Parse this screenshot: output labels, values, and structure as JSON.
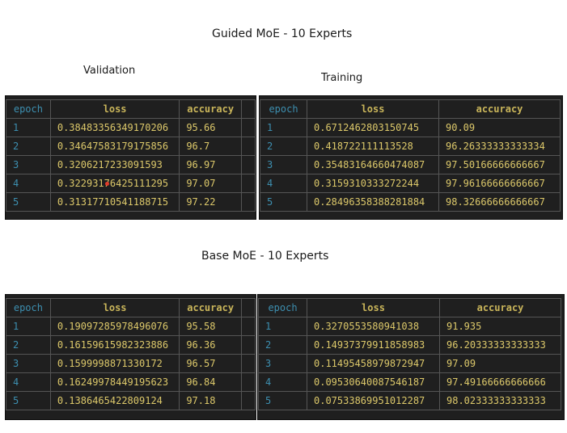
{
  "titles": {
    "guided": "Guided MoE - 10 Experts",
    "base": "Base MoE - 10 Experts",
    "validation": "Validation",
    "training": "Training"
  },
  "columns": {
    "epoch": "epoch",
    "loss": "loss",
    "accuracy": "accuracy"
  },
  "tables": {
    "guided_validation": [
      {
        "epoch": "1",
        "loss": "0.38483356349170206",
        "accuracy": "95.66"
      },
      {
        "epoch": "2",
        "loss": "0.34647583179175856",
        "accuracy": "96.7"
      },
      {
        "epoch": "3",
        "loss": "0.3206217233091593",
        "accuracy": "96.97"
      },
      {
        "epoch": "4",
        "loss": "0.32293176425111295",
        "accuracy": "97.07"
      },
      {
        "epoch": "5",
        "loss": "0.31317710541188715",
        "accuracy": "97.22"
      }
    ],
    "guided_training": [
      {
        "epoch": "1",
        "loss": "0.6712462803150745",
        "accuracy": "90.09"
      },
      {
        "epoch": "2",
        "loss": "0.418722111113528",
        "accuracy": "96.26333333333334"
      },
      {
        "epoch": "3",
        "loss": "0.35483164660474087",
        "accuracy": "97.50166666666667"
      },
      {
        "epoch": "4",
        "loss": "0.3159310333272244",
        "accuracy": "97.96166666666667"
      },
      {
        "epoch": "5",
        "loss": "0.28496358388281884",
        "accuracy": "98.32666666666667"
      }
    ],
    "base_validation": [
      {
        "epoch": "1",
        "loss": "0.19097285978496076",
        "accuracy": "95.58"
      },
      {
        "epoch": "2",
        "loss": "0.16159615982323886",
        "accuracy": "96.36"
      },
      {
        "epoch": "3",
        "loss": "0.1599998871330172",
        "accuracy": "96.57"
      },
      {
        "epoch": "4",
        "loss": "0.16249978449195623",
        "accuracy": "96.84"
      },
      {
        "epoch": "5",
        "loss": "0.1386465422809124",
        "accuracy": "97.18"
      }
    ],
    "base_training": [
      {
        "epoch": "1",
        "loss": "0.3270553580941038",
        "accuracy": "91.935"
      },
      {
        "epoch": "2",
        "loss": "0.14937379911858983",
        "accuracy": "96.20333333333333"
      },
      {
        "epoch": "3",
        "loss": "0.11495458979872947",
        "accuracy": "97.09"
      },
      {
        "epoch": "4",
        "loss": "0.09530640087546187",
        "accuracy": "97.49166666666666"
      },
      {
        "epoch": "5",
        "loss": "0.07533869951012287",
        "accuracy": "98.02333333333333"
      }
    ]
  },
  "colors": {
    "panel_bg": "#1f1f1f",
    "header_text": "#c9b55a",
    "value_text": "#dcc86a",
    "index_text": "#3d8fb0",
    "grid": "#555555",
    "annotation_dot": "#e23b2a"
  }
}
